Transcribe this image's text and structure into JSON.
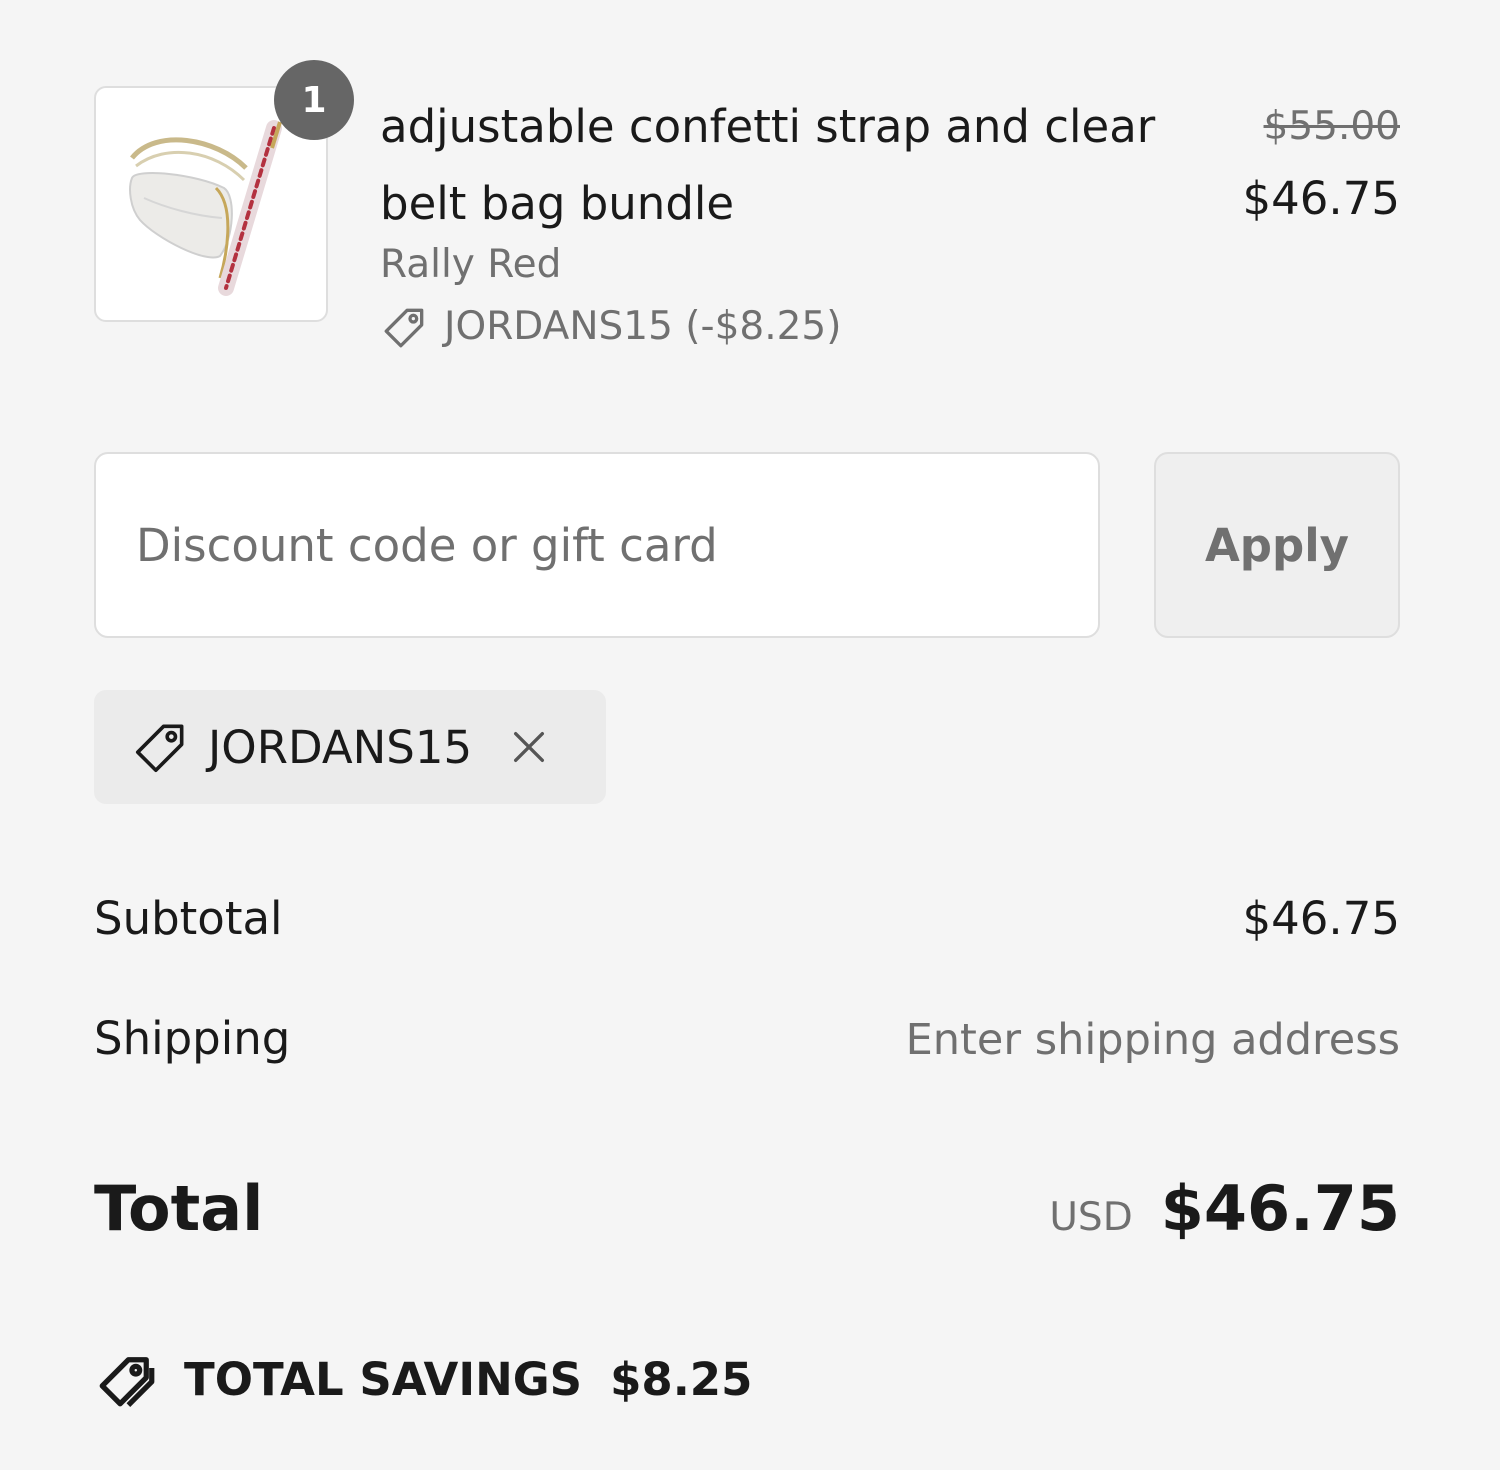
{
  "line_item": {
    "quantity": "1",
    "title": "adjustable confetti strap and clear belt bag bundle",
    "variant": "Rally Red",
    "discount_applied": "JORDANS15 (-$8.25)",
    "price_original": "$55.00",
    "price_current": "$46.75",
    "thumbnail_icon": "product-image"
  },
  "discount": {
    "placeholder": "Discount code or gift card",
    "value": "",
    "apply_label": "Apply"
  },
  "applied_code": {
    "label": "JORDANS15",
    "icon": "tag-icon",
    "remove_icon": "close-icon"
  },
  "totals": {
    "subtotal_label": "Subtotal",
    "subtotal_value": "$46.75",
    "shipping_label": "Shipping",
    "shipping_value": "Enter shipping address",
    "total_label": "Total",
    "currency": "USD",
    "total_value": "$46.75"
  },
  "savings": {
    "label": "TOTAL SAVINGS",
    "amount": "$8.25",
    "icon": "savings-tag-icon"
  },
  "colors": {
    "background": "#f5f5f5",
    "text": "#1a1a1a",
    "muted": "#707070",
    "badge": "#666666"
  }
}
